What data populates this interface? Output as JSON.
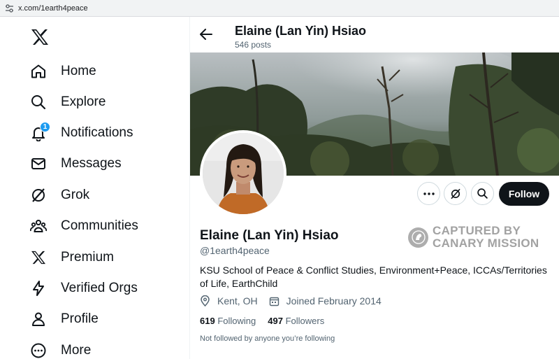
{
  "browser": {
    "url": "x.com/1earth4peace"
  },
  "sidebar": {
    "items": [
      {
        "label": "Home",
        "icon": "home-icon"
      },
      {
        "label": "Explore",
        "icon": "search-icon"
      },
      {
        "label": "Notifications",
        "icon": "bell-icon",
        "badge": "1"
      },
      {
        "label": "Messages",
        "icon": "envelope-icon"
      },
      {
        "label": "Grok",
        "icon": "grok-icon"
      },
      {
        "label": "Communities",
        "icon": "people-icon"
      },
      {
        "label": "Premium",
        "icon": "x-logo-icon"
      },
      {
        "label": "Verified Orgs",
        "icon": "lightning-icon"
      },
      {
        "label": "Profile",
        "icon": "person-icon"
      },
      {
        "label": "More",
        "icon": "more-circle-icon"
      }
    ]
  },
  "header": {
    "name": "Elaine (Lan Yin) Hsiao",
    "posts": "546 posts"
  },
  "profile": {
    "name": "Elaine (Lan Yin) Hsiao",
    "handle": "@1earth4peace",
    "bio": "KSU School of Peace & Conflict Studies, Environment+Peace, ICCAs/Territories of Life, EarthChild",
    "location": "Kent, OH",
    "joined": "Joined February 2014",
    "following_count": "619",
    "following_label": "Following",
    "followers_count": "497",
    "followers_label": "Followers",
    "not_followed": "Not followed by anyone you’re following",
    "follow_label": "Follow"
  },
  "watermark": {
    "line1": "CAPTURED BY",
    "line2": "CANARY MISSION"
  },
  "colors": {
    "accent": "#1d9bf0",
    "text": "#0f1419",
    "secondary": "#536471",
    "follow_bg": "#0f1419"
  }
}
